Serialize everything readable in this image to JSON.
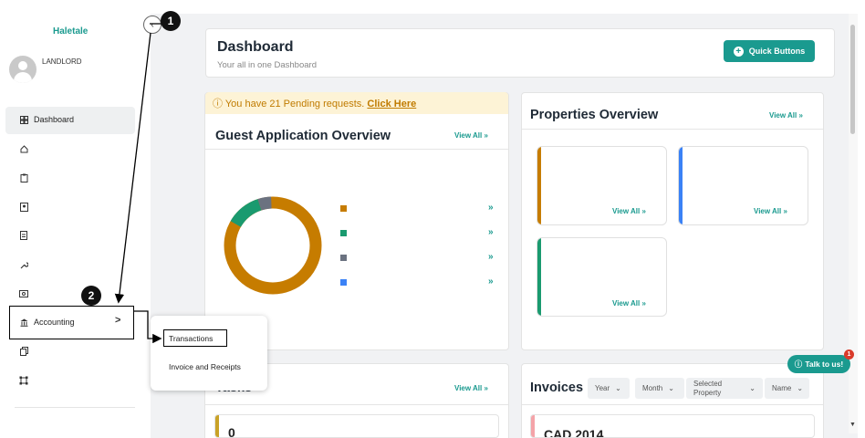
{
  "brand": "Haletale",
  "user_role": "LANDLORD",
  "sidebar": {
    "dashboard_label": "Dashboard",
    "accounting_label": "Accounting",
    "accounting_chevron": ">"
  },
  "header": {
    "title": "Dashboard",
    "subtitle": "Your all in one Dashboard",
    "quick_buttons_label": "Quick Buttons"
  },
  "pending": {
    "text": "You have 21 Pending requests.",
    "link": "Click Here"
  },
  "guest_overview": {
    "title": "Guest Application Overview",
    "view_all": "View All",
    "chevron": "»",
    "legend_colors": [
      "#c67c00",
      "#1a9a6f",
      "#6b7280",
      "#3b82f6"
    ]
  },
  "properties_overview": {
    "title": "Properties Overview",
    "view_all": "View All",
    "cards": [
      {
        "view_all": "View All",
        "color": "#c67c00"
      },
      {
        "view_all": "View All",
        "color": "#3b82f6"
      },
      {
        "view_all": "View All",
        "color": "#1a9a6f"
      }
    ]
  },
  "tasks": {
    "title": "Tasks",
    "view_all": "View All",
    "first_value": "0"
  },
  "invoices": {
    "title": "Invoices",
    "filters": {
      "year": "Year",
      "month": "Month",
      "property": "Selected Property",
      "name": "Name"
    },
    "first_row": "CAD 2014"
  },
  "accounting_menu": {
    "items": [
      "Transactions",
      "Invoice and Receipts"
    ]
  },
  "annotations": {
    "step1": "1",
    "step2": "2"
  },
  "chat": {
    "label": "Talk to us!",
    "badge": "1"
  },
  "colors": {
    "accent": "#1a9a8f",
    "warning_bg": "#fdf3d6",
    "warning_text": "#c07b00"
  }
}
